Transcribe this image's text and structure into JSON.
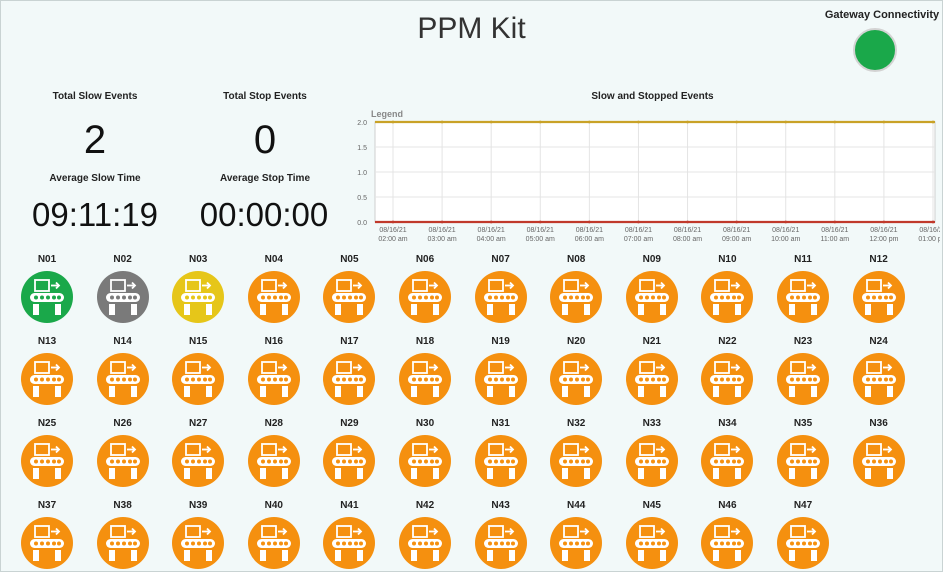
{
  "title": "PPM Kit",
  "gateway": {
    "label": "Gateway Connectivity",
    "status_color": "#1aa84a"
  },
  "stats": {
    "slow_label": "Total Slow Events",
    "slow_value": "2",
    "stop_label": "Total Stop Events",
    "stop_value": "0",
    "avg_slow_label": "Average Slow Time",
    "avg_slow_value": "09:11:19",
    "avg_stop_label": "Average Stop Time",
    "avg_stop_value": "00:00:00"
  },
  "chart_data": {
    "type": "line",
    "title": "Slow and Stopped Events",
    "legend_label": "Legend",
    "ylim": [
      0,
      2.0
    ],
    "y_ticks": [
      "0.0",
      "0.5",
      "1.0",
      "1.5",
      "2.0"
    ],
    "x_ticks": [
      [
        "08/16/21",
        "02:00 am"
      ],
      [
        "08/16/21",
        "03:00 am"
      ],
      [
        "08/16/21",
        "04:00 am"
      ],
      [
        "08/16/21",
        "05:00 am"
      ],
      [
        "08/16/21",
        "06:00 am"
      ],
      [
        "08/16/21",
        "07:00 am"
      ],
      [
        "08/16/21",
        "08:00 am"
      ],
      [
        "08/16/21",
        "09:00 am"
      ],
      [
        "08/16/21",
        "10:00 am"
      ],
      [
        "08/16/21",
        "11:00 am"
      ],
      [
        "08/16/21",
        "12:00 pm"
      ],
      [
        "08/16/21",
        "01:00 pm"
      ]
    ],
    "series": [
      {
        "color": "#c9a227",
        "values": [
          2,
          2,
          2,
          2,
          2,
          2,
          2,
          2,
          2,
          2,
          2,
          2
        ]
      },
      {
        "color": "#c0392b",
        "values": [
          0,
          0,
          0,
          0,
          0,
          0,
          0,
          0,
          0,
          0,
          0,
          0
        ]
      }
    ],
    "grid": true
  },
  "colors": {
    "green": "#1aa84a",
    "gray": "#7a7a7a",
    "yellow": "#e6c619",
    "orange": "#f5900f"
  },
  "nodes": [
    {
      "label": "N01",
      "status": "green"
    },
    {
      "label": "N02",
      "status": "gray"
    },
    {
      "label": "N03",
      "status": "yellow"
    },
    {
      "label": "N04",
      "status": "orange"
    },
    {
      "label": "N05",
      "status": "orange"
    },
    {
      "label": "N06",
      "status": "orange"
    },
    {
      "label": "N07",
      "status": "orange"
    },
    {
      "label": "N08",
      "status": "orange"
    },
    {
      "label": "N09",
      "status": "orange"
    },
    {
      "label": "N10",
      "status": "orange"
    },
    {
      "label": "N11",
      "status": "orange"
    },
    {
      "label": "N12",
      "status": "orange"
    },
    {
      "label": "N13",
      "status": "orange"
    },
    {
      "label": "N14",
      "status": "orange"
    },
    {
      "label": "N15",
      "status": "orange"
    },
    {
      "label": "N16",
      "status": "orange"
    },
    {
      "label": "N17",
      "status": "orange"
    },
    {
      "label": "N18",
      "status": "orange"
    },
    {
      "label": "N19",
      "status": "orange"
    },
    {
      "label": "N20",
      "status": "orange"
    },
    {
      "label": "N21",
      "status": "orange"
    },
    {
      "label": "N22",
      "status": "orange"
    },
    {
      "label": "N23",
      "status": "orange"
    },
    {
      "label": "N24",
      "status": "orange"
    },
    {
      "label": "N25",
      "status": "orange"
    },
    {
      "label": "N26",
      "status": "orange"
    },
    {
      "label": "N27",
      "status": "orange"
    },
    {
      "label": "N28",
      "status": "orange"
    },
    {
      "label": "N29",
      "status": "orange"
    },
    {
      "label": "N30",
      "status": "orange"
    },
    {
      "label": "N31",
      "status": "orange"
    },
    {
      "label": "N32",
      "status": "orange"
    },
    {
      "label": "N33",
      "status": "orange"
    },
    {
      "label": "N34",
      "status": "orange"
    },
    {
      "label": "N35",
      "status": "orange"
    },
    {
      "label": "N36",
      "status": "orange"
    },
    {
      "label": "N37",
      "status": "orange"
    },
    {
      "label": "N38",
      "status": "orange"
    },
    {
      "label": "N39",
      "status": "orange"
    },
    {
      "label": "N40",
      "status": "orange"
    },
    {
      "label": "N41",
      "status": "orange"
    },
    {
      "label": "N42",
      "status": "orange"
    },
    {
      "label": "N43",
      "status": "orange"
    },
    {
      "label": "N44",
      "status": "orange"
    },
    {
      "label": "N45",
      "status": "orange"
    },
    {
      "label": "N46",
      "status": "orange"
    },
    {
      "label": "N47",
      "status": "orange"
    }
  ],
  "node_icon": "conveyor-machine-icon"
}
